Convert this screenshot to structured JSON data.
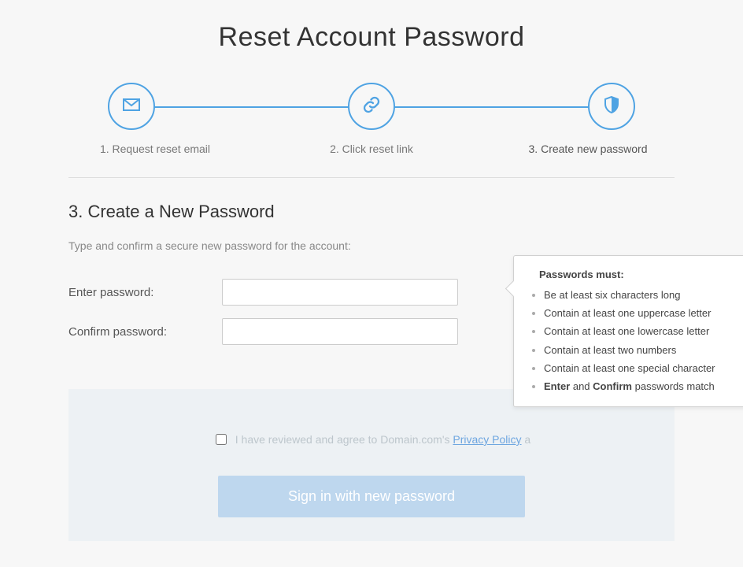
{
  "title": "Reset Account Password",
  "stepper": {
    "step1": {
      "label": "1. Request reset email"
    },
    "step2": {
      "label": "2. Click reset link"
    },
    "step3": {
      "label": "3. Create new password"
    }
  },
  "form": {
    "heading": "3. Create a New Password",
    "subtext": "Type and confirm a secure new password for the account:",
    "enter_label": "Enter password:",
    "confirm_label": "Confirm password:",
    "enter_value": "",
    "confirm_value": ""
  },
  "tooltip": {
    "title": "Passwords must:",
    "rule1": "Be at least six characters long",
    "rule2": "Contain at least one uppercase letter",
    "rule3": "Contain at least one lowercase letter",
    "rule4": "Contain at least two numbers",
    "rule5": "Contain at least one special character",
    "rule6_a": "Enter",
    "rule6_mid": " and ",
    "rule6_b": "Confirm",
    "rule6_tail": " passwords match"
  },
  "agreement": {
    "text_pre": "I have reviewed and agree to Domain.com's ",
    "privacy_link": "Privacy Policy",
    "text_tail": " a"
  },
  "button": {
    "label": "Sign in with new password"
  },
  "colors": {
    "accent": "#4fa3e3"
  }
}
